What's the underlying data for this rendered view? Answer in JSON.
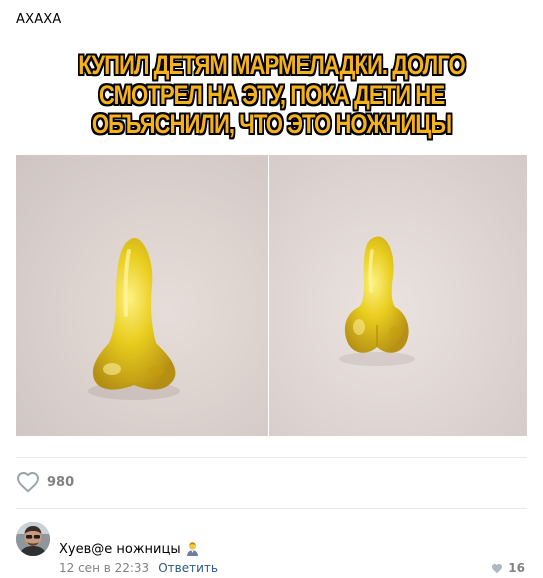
{
  "post": {
    "text": "АХАХА",
    "meme": {
      "caption_lines": [
        "КУПИЛ ДЕТЯМ МАРМЕЛАДКИ. ДОЛГО",
        "СМОТРЕЛ НА ЭТУ, ПОКА ДЕТИ НЕ",
        "ОБЪЯСНИЛИ, ЧТО ЭТО НОЖНИЦЫ"
      ],
      "caption_color": "#f6b21b",
      "candy_color": "#e9cc10"
    },
    "likes": {
      "count": "980",
      "icon": "heart-outline-icon"
    }
  },
  "comment": {
    "text": "Хуев@е ножницы",
    "emoji": "man-icon",
    "date": "12 сен в 22:33",
    "reply_label": "Ответить",
    "likes": "16",
    "likes_icon": "heart-filled-icon"
  },
  "colors": {
    "link": "#2a5885",
    "muted": "#828282",
    "divider": "#e7e8ec"
  }
}
